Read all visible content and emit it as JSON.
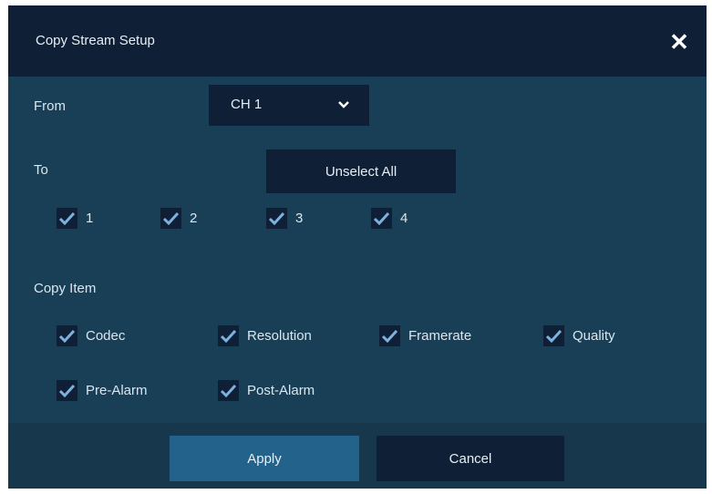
{
  "dialog": {
    "title": "Copy Stream Setup",
    "close_icon": "close-icon"
  },
  "from": {
    "label": "From",
    "selected": "CH 1",
    "icon": "chevron-down-icon"
  },
  "to": {
    "label": "To",
    "unselect_all": "Unselect All",
    "channels": [
      {
        "label": "1",
        "checked": true
      },
      {
        "label": "2",
        "checked": true
      },
      {
        "label": "3",
        "checked": true
      },
      {
        "label": "4",
        "checked": true
      }
    ]
  },
  "copy_item": {
    "label": "Copy Item",
    "items": [
      {
        "label": "Codec",
        "checked": true
      },
      {
        "label": "Resolution",
        "checked": true
      },
      {
        "label": "Framerate",
        "checked": true
      },
      {
        "label": "Quality",
        "checked": true
      },
      {
        "label": "Pre-Alarm",
        "checked": true
      },
      {
        "label": "Post-Alarm",
        "checked": true
      }
    ]
  },
  "buttons": {
    "apply": "Apply",
    "cancel": "Cancel"
  },
  "colors": {
    "panel": "#193f56",
    "titlebar": "#0f1f36",
    "control": "#0f1f36",
    "apply": "#22628b",
    "check": "#7cb2e0"
  }
}
